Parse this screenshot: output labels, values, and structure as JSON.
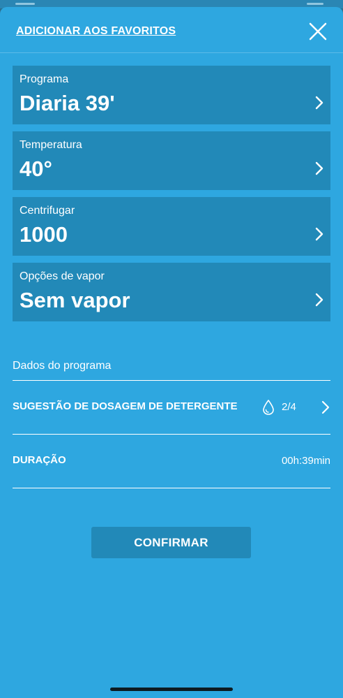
{
  "header": {
    "favorites_link": "ADICIONAR AOS FAVORITOS",
    "close_icon": "close-icon"
  },
  "settings": [
    {
      "label": "Programa",
      "value": "Diaria 39'"
    },
    {
      "label": "Temperatura",
      "value": "40°"
    },
    {
      "label": "Centrifugar",
      "value": "1000"
    },
    {
      "label": "Opções de vapor",
      "value": "Sem vapor"
    }
  ],
  "program_data": {
    "title": "Dados do programa",
    "detergent": {
      "label": "SUGESTÃO DE DOSAGEM DE DETERGENTE",
      "icon": "water-drop-icon",
      "value": "2/4"
    },
    "duration": {
      "label": "DURAÇÃO",
      "value": "00h:39min"
    }
  },
  "confirm_label": "CONFIRMAR",
  "colors": {
    "background": "#2ea7e0",
    "card": "#2289b8",
    "text": "#ffffff"
  }
}
